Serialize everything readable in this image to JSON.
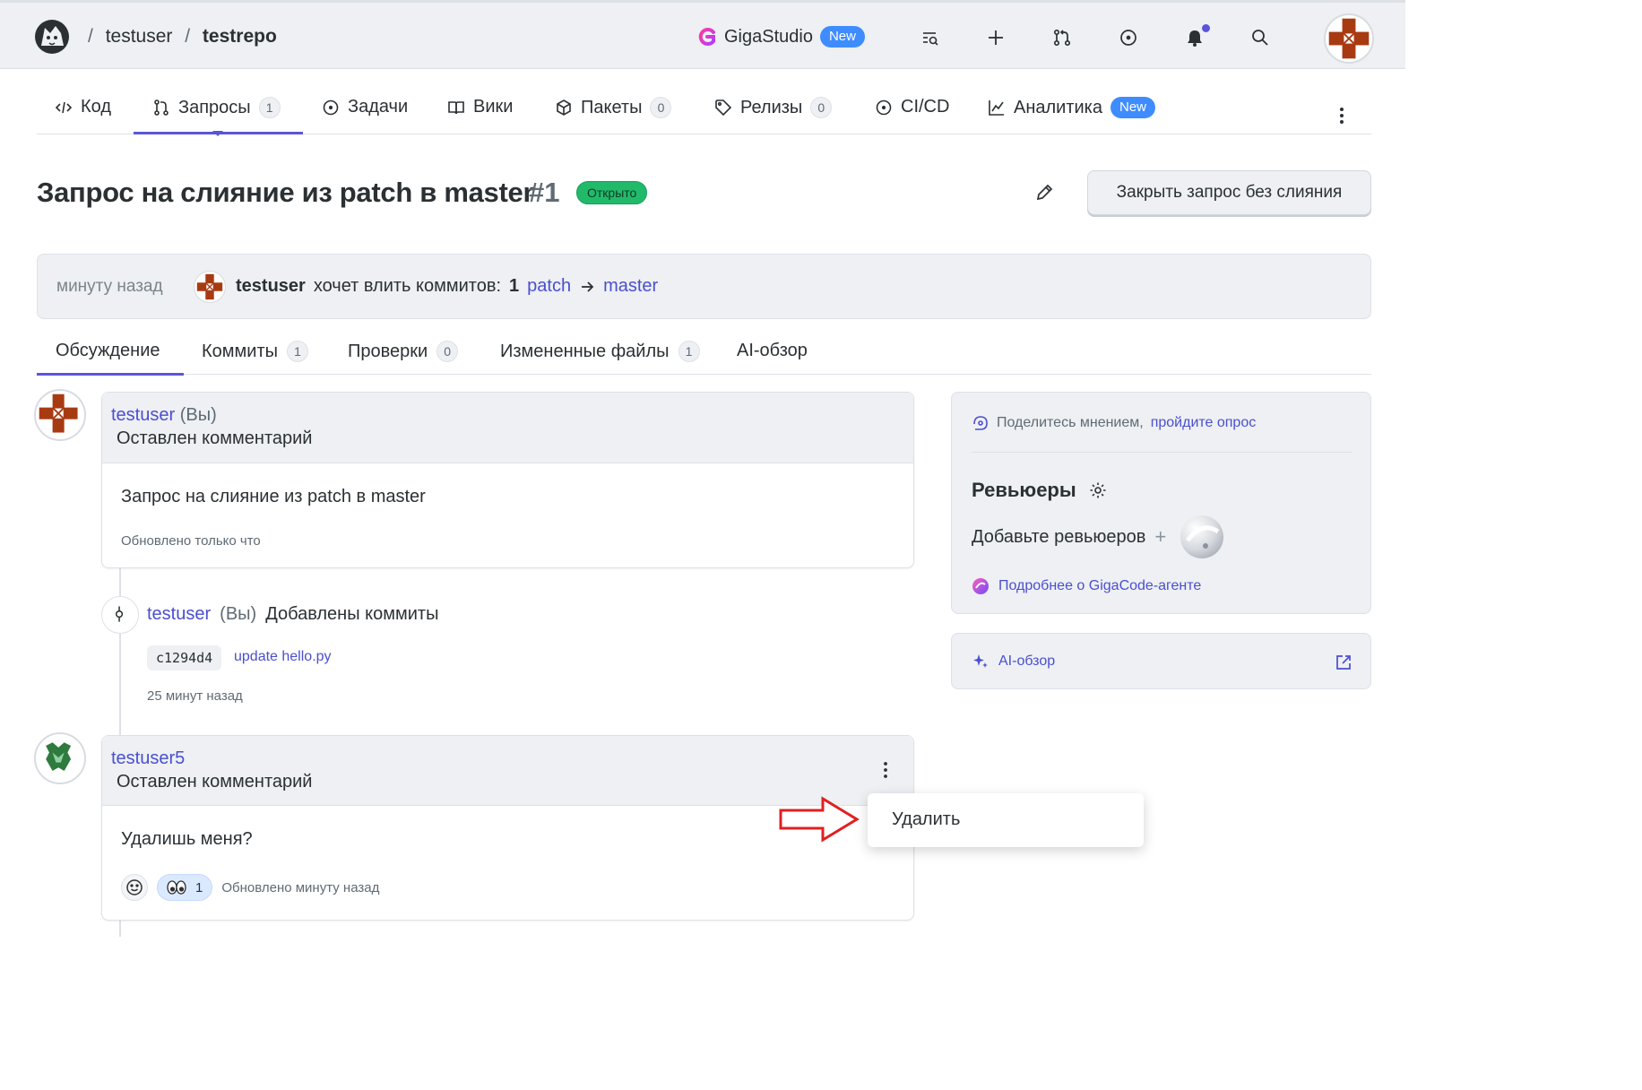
{
  "topbar": {
    "owner": "testuser",
    "repo": "testrepo",
    "product": "GigaStudio",
    "product_badge": "New",
    "icons": [
      "search-list-icon",
      "plus-icon",
      "pull-request-icon",
      "issue-icon",
      "bell-icon",
      "search-icon",
      "avatar"
    ]
  },
  "repo_tabs": [
    {
      "label": "Код",
      "icon": "code-icon"
    },
    {
      "label": "Запросы",
      "count": "1",
      "icon": "pull-request-icon",
      "active": true
    },
    {
      "label": "Задачи",
      "icon": "issue-icon"
    },
    {
      "label": "Вики",
      "icon": "book-icon"
    },
    {
      "label": "Пакеты",
      "count": "0",
      "icon": "package-icon"
    },
    {
      "label": "Релизы",
      "count": "0",
      "icon": "tag-icon"
    },
    {
      "label": "CI/CD",
      "icon": "cicd-icon"
    },
    {
      "label": "Аналитика",
      "badge": "New",
      "icon": "chart-icon"
    }
  ],
  "pr": {
    "title": "Запрос на слияние из patch в master",
    "number": "#1",
    "status": "Открыто",
    "close_button": "Закрыть запрос без слияния"
  },
  "info": {
    "time": "минуту назад",
    "user": "testuser",
    "text": "хочет влить коммитов:",
    "count": "1",
    "from_branch": "patch",
    "to_branch": "master"
  },
  "discussion_tabs": [
    {
      "label": "Обсуждение",
      "active": true
    },
    {
      "label": "Коммиты",
      "count": "1"
    },
    {
      "label": "Проверки",
      "count": "0"
    },
    {
      "label": "Измененные файлы",
      "count": "1"
    },
    {
      "label": "AI-обзор"
    }
  ],
  "comment1": {
    "user": "testuser",
    "you": "(Вы)",
    "action": "Оставлен комментарий",
    "text": "Запрос на слияние из patch в master",
    "updated": "Обновлено только что"
  },
  "commit_event": {
    "user": "testuser",
    "you": "(Вы)",
    "action": "Добавлены коммиты",
    "sha": "c1294d4",
    "message": "update hello.py",
    "time": "25 минут назад"
  },
  "comment2": {
    "user": "testuser5",
    "action": "Оставлен комментарий",
    "text": "Удалишь меня?",
    "reaction_count": "1",
    "updated": "Обновлено минуту назад"
  },
  "dropdown": {
    "delete": "Удалить"
  },
  "sidebar": {
    "survey_text": "Поделитесь мнением,",
    "survey_link": "пройдите опрос",
    "reviewers_title": "Ревьюеры",
    "add_reviewers": "Добавьте ревьюеров",
    "gigacode_link": "Подробнее о GigaCode-агенте",
    "ai_review": "AI-обзор"
  },
  "colors": {
    "accent": "#5b55d9",
    "link": "#4a4fcf",
    "open_badge": "#21ba6b",
    "new_badge": "#3f8cff",
    "arrow": "#e02020"
  }
}
